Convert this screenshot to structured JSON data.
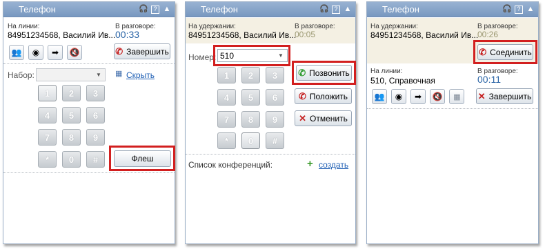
{
  "panel_title": "Телефон",
  "p1": {
    "line_label": "На линии:",
    "line_value": "84951234568,  Василий Ив...",
    "talk_label": "В разговоре:",
    "talk_time": "00:33",
    "end_label": "Завершить",
    "dial_label": "Набор:",
    "dial_value": "",
    "hide_label": "Скрыть",
    "flash_label": "Флеш"
  },
  "p2": {
    "hold_label": "На удержании:",
    "hold_value": "84951234568,  Василий Ив...",
    "talk_label": "В разговоре:",
    "talk_time": "00:05",
    "number_label": "Номер:",
    "number_value": "510",
    "call_label": "Позвонить",
    "hangup_label": "Положить",
    "cancel_label": "Отменить",
    "conf_label": "Список конференций:",
    "create_label": "создать"
  },
  "p3": {
    "hold_label": "На удержании:",
    "hold_value": "84951234568,  Василий Ив...",
    "talk_label": "В разговоре:",
    "hold_time": "00:26",
    "connect_label": "Соединить",
    "line_label": "На линии:",
    "line_value": "510, Справочная",
    "talk_label2": "В разговоре:",
    "talk_time": "00:11",
    "end_label": "Завершить"
  },
  "keys": [
    "1",
    "2",
    "3",
    "4",
    "5",
    "6",
    "7",
    "8",
    "9",
    "*",
    "0",
    "#"
  ],
  "colors": {
    "titlebar": "#7f9ec6",
    "timer": "#2a64a6",
    "highlight": "#d21f1f",
    "hold_bg": "#f4f0e3"
  }
}
